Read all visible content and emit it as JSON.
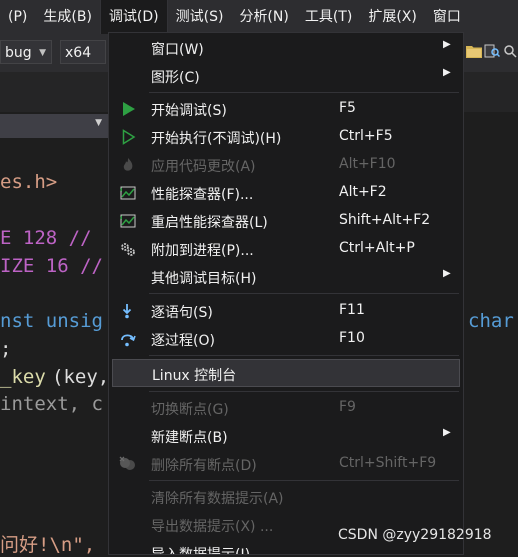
{
  "menubar": {
    "items": [
      {
        "label": "(P)"
      },
      {
        "label": "生成(B)"
      },
      {
        "label": "调试(D)"
      },
      {
        "label": "测试(S)"
      },
      {
        "label": "分析(N)"
      },
      {
        "label": "工具(T)"
      },
      {
        "label": "扩展(X)"
      },
      {
        "label": "窗口"
      }
    ]
  },
  "toolbar": {
    "config_value": "bug",
    "platform_value": "x64"
  },
  "editor": {
    "lines": [
      {
        "t1": "es.h>"
      },
      {
        "t1": "E 128 //"
      },
      {
        "t1": "IZE 16 //"
      },
      {
        "t1": "nst unsig",
        "t2": "char"
      },
      {
        "t1": ";"
      },
      {
        "t1": "_key",
        "t2": "(key,"
      },
      {
        "t1": "intext, c"
      },
      {
        "t1": "问好!\\n\","
      }
    ]
  },
  "menu": {
    "items": [
      {
        "label": "窗口(W)",
        "shortcut": "",
        "icon": "",
        "submenu": true,
        "enabled": true
      },
      {
        "label": "图形(C)",
        "shortcut": "",
        "icon": "",
        "submenu": true,
        "enabled": true
      },
      {
        "label": "开始调试(S)",
        "shortcut": "F5",
        "icon": "play-filled-icon",
        "submenu": false,
        "enabled": true
      },
      {
        "label": "开始执行(不调试)(H)",
        "shortcut": "Ctrl+F5",
        "icon": "play-outline-icon",
        "submenu": false,
        "enabled": true
      },
      {
        "label": "应用代码更改(A)",
        "shortcut": "Alt+F10",
        "icon": "flame-icon",
        "submenu": false,
        "enabled": false
      },
      {
        "label": "性能探查器(F)...",
        "shortcut": "Alt+F2",
        "icon": "performance-chart-icon",
        "submenu": false,
        "enabled": true
      },
      {
        "label": "重启性能探查器(L)",
        "shortcut": "Shift+Alt+F2",
        "icon": "performance-chart-icon",
        "submenu": false,
        "enabled": true
      },
      {
        "label": "附加到进程(P)...",
        "shortcut": "Ctrl+Alt+P",
        "icon": "gears-icon",
        "submenu": false,
        "enabled": true
      },
      {
        "label": "其他调试目标(H)",
        "shortcut": "",
        "icon": "",
        "submenu": true,
        "enabled": true
      },
      {
        "label": "逐语句(S)",
        "shortcut": "F11",
        "icon": "step-into-icon",
        "submenu": false,
        "enabled": true
      },
      {
        "label": "逐过程(O)",
        "shortcut": "F10",
        "icon": "step-over-icon",
        "submenu": false,
        "enabled": true
      },
      {
        "label": "Linux 控制台",
        "shortcut": "",
        "icon": "",
        "submenu": false,
        "enabled": true
      },
      {
        "label": "切换断点(G)",
        "shortcut": "F9",
        "icon": "",
        "submenu": false,
        "enabled": false
      },
      {
        "label": "新建断点(B)",
        "shortcut": "",
        "icon": "",
        "submenu": true,
        "enabled": true
      },
      {
        "label": "删除所有断点(D)",
        "shortcut": "Ctrl+Shift+F9",
        "icon": "delete-breakpoints-icon",
        "submenu": false,
        "enabled": false
      },
      {
        "label": "清除所有数据提示(A)",
        "shortcut": "",
        "icon": "",
        "submenu": false,
        "enabled": false
      },
      {
        "label": "导出数据提示(X) ...",
        "shortcut": "",
        "icon": "",
        "submenu": false,
        "enabled": false
      },
      {
        "label": "导入数据提示(I)...",
        "shortcut": "",
        "icon": "",
        "submenu": false,
        "enabled": true
      }
    ]
  },
  "watermark": "CSDN @zyy29182918"
}
